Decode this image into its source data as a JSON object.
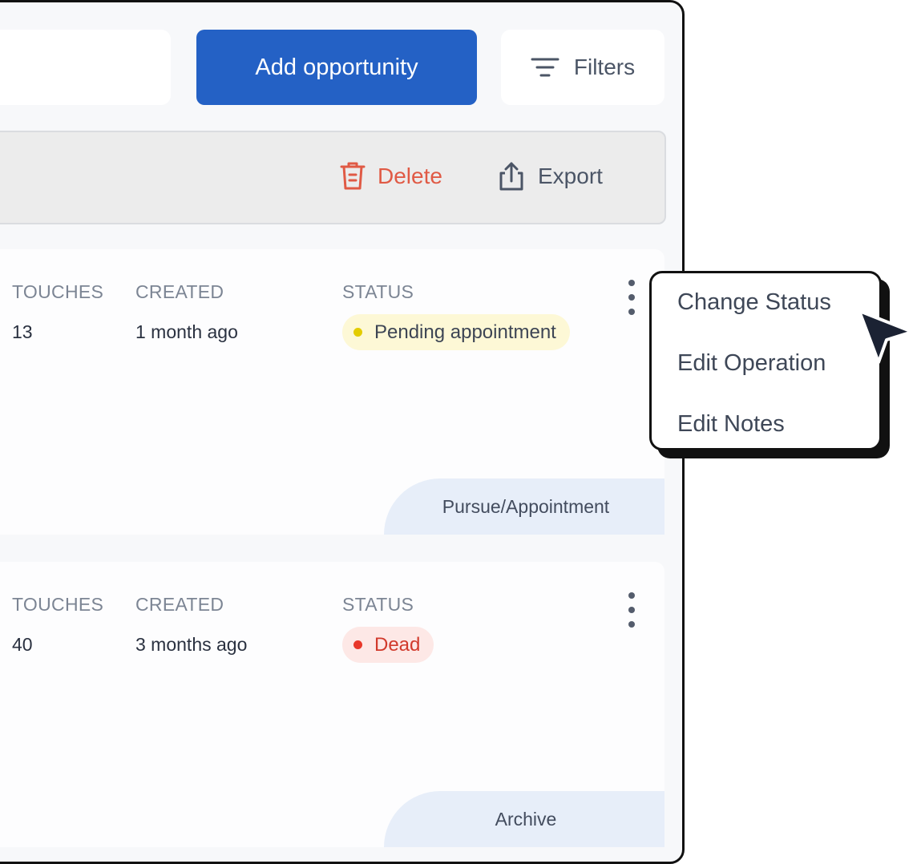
{
  "header": {
    "search_placeholder": "",
    "add_button_label": "Add opportunity",
    "filters_label": "Filters"
  },
  "toolbar": {
    "delete_label": "Delete",
    "export_label": "Export"
  },
  "columns": {
    "touches": "TOUCHES",
    "created": "CREATED",
    "status": "STATUS"
  },
  "cards": [
    {
      "touches": "13",
      "created": "1 month ago",
      "status": "Pending appointment",
      "action": "Pursue/Appointment"
    },
    {
      "touches": "40",
      "created": "3 months ago",
      "status": "Dead",
      "action": "Archive"
    }
  ],
  "context_menu": {
    "items": [
      "Change Status",
      "Edit Operation",
      "Edit Notes"
    ]
  },
  "colors": {
    "primary": "#2461c5",
    "danger": "#e05a45",
    "pending_dot": "#e3cc00",
    "dead_dot": "#e8372a"
  },
  "icons": [
    "filter-icon",
    "trash-icon",
    "export-icon",
    "more-vertical-icon",
    "cursor-icon"
  ]
}
